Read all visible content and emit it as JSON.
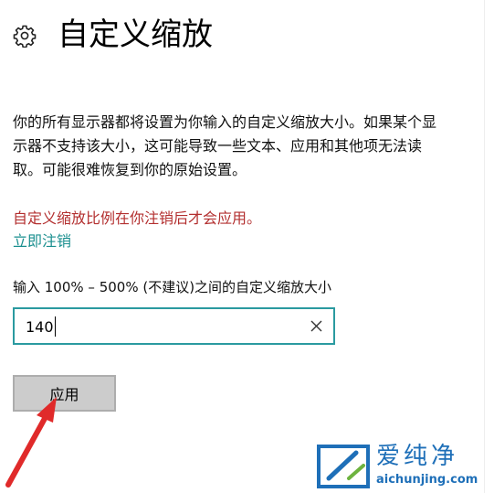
{
  "header": {
    "icon": "gear-icon",
    "title": "自定义缩放"
  },
  "description": {
    "lines": [
      "你的所有显示器都将设置为你输入的自定义缩放大小。如果某个显",
      "示器不支持该大小，这可能导致一些文本、应用和其他项无法读",
      "取。可能很难恢复到你的原始设置。"
    ]
  },
  "notice": {
    "warning": "自定义缩放比例在你注销后才会应用。",
    "signout_link": "立即注销"
  },
  "scale": {
    "label": "输入 100% – 500% (不建议)之间的自定义缩放大小",
    "value": "140",
    "clear_icon": "close-icon"
  },
  "apply_button": {
    "label": "应用"
  },
  "watermark": {
    "name": "爱纯净",
    "url": "aichunjing.com"
  },
  "colors": {
    "warning_text": "#b32f2f",
    "link_text": "#1a8f8f",
    "input_border": "#2a9aa0",
    "annotation_arrow": "#e02a2a",
    "watermark_blue": "#1e6fb8"
  }
}
